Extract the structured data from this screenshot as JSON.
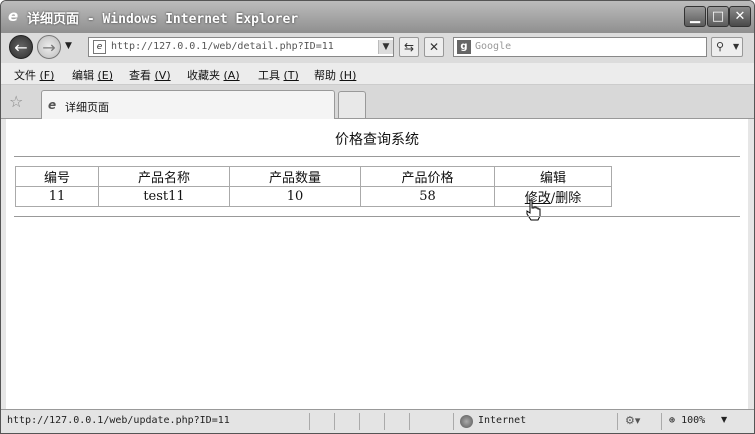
{
  "window": {
    "title": "详细页面 - Windows Internet Explorer",
    "minimize_glyph": "▁",
    "maximize_glyph": "□",
    "close_glyph": "✕"
  },
  "nav": {
    "address": "http://127.0.0.1/web/detail.php?ID=11",
    "search_placeholder": "Google",
    "search_logo": "g"
  },
  "menu": {
    "items": [
      {
        "label": "文件",
        "key": "(F)"
      },
      {
        "label": "编辑",
        "key": "(E)"
      },
      {
        "label": "查看",
        "key": "(V)"
      },
      {
        "label": "收藏夹",
        "key": "(A)"
      },
      {
        "label": "工具",
        "key": "(T)"
      },
      {
        "label": "帮助",
        "key": "(H)"
      }
    ]
  },
  "tab": {
    "label": "详细页面"
  },
  "page": {
    "title": "价格查询系统",
    "table": {
      "headers": [
        "编号",
        "产品名称",
        "产品数量",
        "产品价格",
        "编辑"
      ],
      "rows": [
        {
          "id": "11",
          "name": "test11",
          "quantity": "10",
          "price": "58",
          "edit_label": "修改",
          "separator": "/",
          "delete_label": "删除"
        }
      ]
    }
  },
  "status": {
    "url": "http://127.0.0.1/web/update.php?ID=11",
    "zone": "Internet",
    "zoom": "100%"
  },
  "icons": [
    "ie-logo-icon",
    "back-arrow-icon",
    "forward-arrow-icon",
    "refresh-icon",
    "stop-icon",
    "search-magnifier-icon",
    "favorites-star-icon",
    "hand-cursor-icon",
    "globe-icon",
    "security-icon",
    "zoom-icon"
  ]
}
